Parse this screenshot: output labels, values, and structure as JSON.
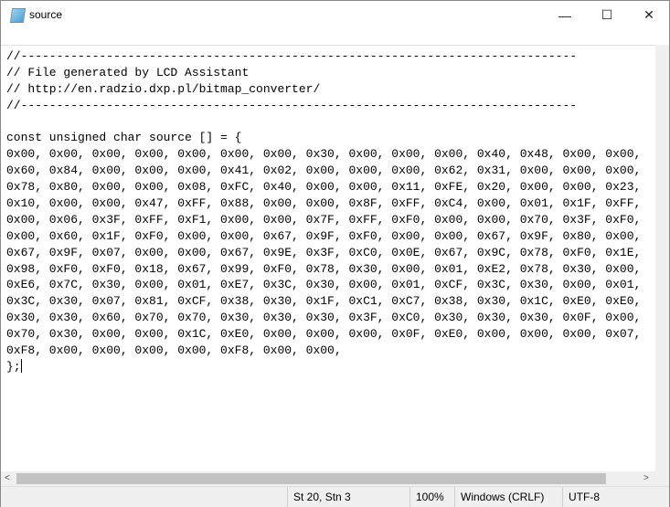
{
  "window": {
    "title": "source",
    "icon": "notepad-icon"
  },
  "controls": {
    "minimize": "—",
    "maximize": "☐",
    "close": "✕"
  },
  "code_lines": [
    "//------------------------------------------------------------------------------",
    "// File generated by LCD Assistant",
    "// http://en.radzio.dxp.pl/bitmap_converter/",
    "//------------------------------------------------------------------------------",
    "",
    "const unsigned char source [] = {",
    "0x00, 0x00, 0x00, 0x00, 0x00, 0x00, 0x00, 0x30, 0x00, 0x00, 0x00, 0x40, 0x48, 0x00, 0x00,",
    "0x60, 0x84, 0x00, 0x00, 0x00, 0x41, 0x02, 0x00, 0x00, 0x00, 0x62, 0x31, 0x00, 0x00, 0x00,",
    "0x78, 0x80, 0x00, 0x00, 0x08, 0xFC, 0x40, 0x00, 0x00, 0x11, 0xFE, 0x20, 0x00, 0x00, 0x23,",
    "0x10, 0x00, 0x00, 0x47, 0xFF, 0x88, 0x00, 0x00, 0x8F, 0xFF, 0xC4, 0x00, 0x01, 0x1F, 0xFF,",
    "0x00, 0x06, 0x3F, 0xFF, 0xF1, 0x00, 0x00, 0x7F, 0xFF, 0xF0, 0x00, 0x00, 0x70, 0x3F, 0xF0,",
    "0x00, 0x60, 0x1F, 0xF0, 0x00, 0x00, 0x67, 0x9F, 0xF0, 0x00, 0x00, 0x67, 0x9F, 0x80, 0x00,",
    "0x67, 0x9F, 0x07, 0x00, 0x00, 0x67, 0x9E, 0x3F, 0xC0, 0x0E, 0x67, 0x9C, 0x78, 0xF0, 0x1E,",
    "0x98, 0xF0, 0xF0, 0x18, 0x67, 0x99, 0xF0, 0x78, 0x30, 0x00, 0x01, 0xE2, 0x78, 0x30, 0x00,",
    "0xE6, 0x7C, 0x30, 0x00, 0x01, 0xE7, 0x3C, 0x30, 0x00, 0x01, 0xCF, 0x3C, 0x30, 0x00, 0x01,",
    "0x3C, 0x30, 0x07, 0x81, 0xCF, 0x38, 0x30, 0x1F, 0xC1, 0xC7, 0x38, 0x30, 0x1C, 0xE0, 0xE0,",
    "0x30, 0x30, 0x60, 0x70, 0x70, 0x30, 0x30, 0x30, 0x3F, 0xC0, 0x30, 0x30, 0x30, 0x0F, 0x00,",
    "0x70, 0x30, 0x00, 0x00, 0x1C, 0xE0, 0x00, 0x00, 0x00, 0x0F, 0xE0, 0x00, 0x00, 0x00, 0x07,",
    "0xF8, 0x00, 0x00, 0x00, 0x00, 0xF8, 0x00, 0x00,",
    "};"
  ],
  "status": {
    "position": "St 20, Stn 3",
    "zoom": "100%",
    "line_ending": "Windows (CRLF)",
    "encoding": "UTF-8"
  }
}
